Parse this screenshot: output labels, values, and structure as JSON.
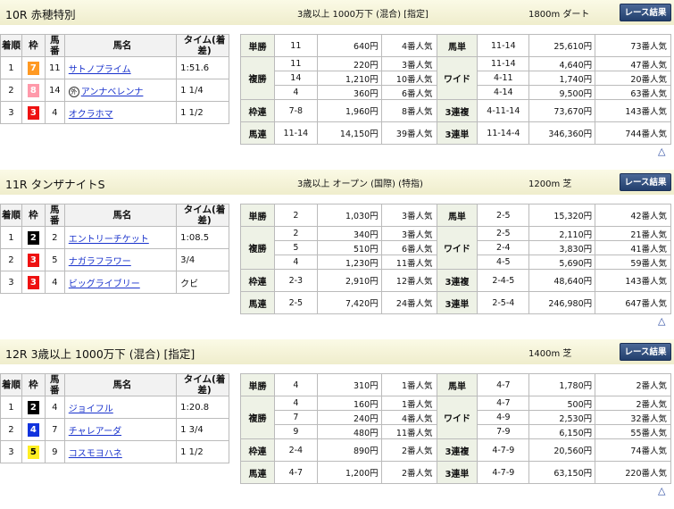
{
  "colors": {
    "waku1": "#ffffff",
    "waku2": "#000000",
    "waku3": "#ee1111",
    "waku4": "#1133dd",
    "waku5": "#ffee22",
    "waku6": "#22aa33",
    "waku7": "#ff9922",
    "waku8": "#ff99aa"
  },
  "result_headers": {
    "pos": "着順",
    "waku": "枠",
    "num": "馬番",
    "name": "馬名",
    "time": "タイム(着差)"
  },
  "races": [
    {
      "name": "10R 赤穂特別",
      "cond": "3歳以上 1000万下 (混合) [指定]",
      "dist": "1800m ダート",
      "btn": "レース結果",
      "results": [
        {
          "pos": "1",
          "waku": "7",
          "num": "11",
          "name": "サトノプライム",
          "mark": "",
          "time": "1:51.6",
          "wbg": "#ff9922",
          "wfg": "#ffffff"
        },
        {
          "pos": "2",
          "waku": "8",
          "num": "14",
          "name": "アンナベレンナ",
          "mark": "外",
          "time": "1 1/4",
          "wbg": "#ff99aa",
          "wfg": "#ffffff"
        },
        {
          "pos": "3",
          "waku": "3",
          "num": "4",
          "name": "オクラホマ",
          "mark": "",
          "time": "1 1/2",
          "wbg": "#ee1111",
          "wfg": "#ffffff"
        }
      ],
      "pay": {
        "tan": {
          "l": "単勝",
          "c": "11",
          "a": "640円",
          "p": "4番人気"
        },
        "fuku": {
          "l": "複勝",
          "c": [
            "11",
            "14",
            "4"
          ],
          "a": [
            "220円",
            "1,210円",
            "360円"
          ],
          "p": [
            "3番人気",
            "10番人気",
            "6番人気"
          ]
        },
        "waku": {
          "l": "枠連",
          "c": "7-8",
          "a": "1,960円",
          "p": "8番人気"
        },
        "umaren": {
          "l": "馬連",
          "c": "11-14",
          "a": "14,150円",
          "p": "39番人気"
        },
        "umatan": {
          "l": "馬単",
          "c": "11-14",
          "a": "25,610円",
          "p": "73番人気"
        },
        "wide": {
          "l": "ワイド",
          "c": [
            "11-14",
            "4-11",
            "4-14"
          ],
          "a": [
            "4,640円",
            "1,740円",
            "9,500円"
          ],
          "p": [
            "47番人気",
            "20番人気",
            "63番人気"
          ]
        },
        "trio": {
          "l": "3連複",
          "c": "4-11-14",
          "a": "73,670円",
          "p": "143番人気"
        },
        "trifecta": {
          "l": "3連単",
          "c": "11-14-4",
          "a": "346,360円",
          "p": "744番人気"
        }
      }
    },
    {
      "name": "11R タンザナイトS",
      "cond": "3歳以上 オープン (国際) (特指)",
      "dist": "1200m 芝",
      "btn": "レース結果",
      "results": [
        {
          "pos": "1",
          "waku": "2",
          "num": "2",
          "name": "エントリーチケット",
          "mark": "",
          "time": "1:08.5",
          "wbg": "#000000",
          "wfg": "#ffffff"
        },
        {
          "pos": "2",
          "waku": "3",
          "num": "5",
          "name": "ナガラフラワー",
          "mark": "",
          "time": "3/4",
          "wbg": "#ee1111",
          "wfg": "#ffffff"
        },
        {
          "pos": "3",
          "waku": "3",
          "num": "4",
          "name": "ビッグライブリー",
          "mark": "",
          "time": "クビ",
          "wbg": "#ee1111",
          "wfg": "#ffffff"
        }
      ],
      "pay": {
        "tan": {
          "l": "単勝",
          "c": "2",
          "a": "1,030円",
          "p": "3番人気"
        },
        "fuku": {
          "l": "複勝",
          "c": [
            "2",
            "5",
            "4"
          ],
          "a": [
            "340円",
            "510円",
            "1,230円"
          ],
          "p": [
            "3番人気",
            "6番人気",
            "11番人気"
          ]
        },
        "waku": {
          "l": "枠連",
          "c": "2-3",
          "a": "2,910円",
          "p": "12番人気"
        },
        "umaren": {
          "l": "馬連",
          "c": "2-5",
          "a": "7,420円",
          "p": "24番人気"
        },
        "umatan": {
          "l": "馬単",
          "c": "2-5",
          "a": "15,320円",
          "p": "42番人気"
        },
        "wide": {
          "l": "ワイド",
          "c": [
            "2-5",
            "2-4",
            "4-5"
          ],
          "a": [
            "2,110円",
            "3,830円",
            "5,690円"
          ],
          "p": [
            "21番人気",
            "41番人気",
            "59番人気"
          ]
        },
        "trio": {
          "l": "3連複",
          "c": "2-4-5",
          "a": "48,640円",
          "p": "143番人気"
        },
        "trifecta": {
          "l": "3連単",
          "c": "2-5-4",
          "a": "246,980円",
          "p": "647番人気"
        }
      }
    },
    {
      "name": "12R 3歳以上 1000万下 (混合) [指定]",
      "cond": "",
      "dist": "1400m 芝",
      "btn": "レース結果",
      "results": [
        {
          "pos": "1",
          "waku": "2",
          "num": "4",
          "name": "ジョイフル",
          "mark": "",
          "time": "1:20.8",
          "wbg": "#000000",
          "wfg": "#ffffff"
        },
        {
          "pos": "2",
          "waku": "4",
          "num": "7",
          "name": "チャレアーダ",
          "mark": "",
          "time": "1 3/4",
          "wbg": "#1133dd",
          "wfg": "#ffffff"
        },
        {
          "pos": "3",
          "waku": "5",
          "num": "9",
          "name": "コスモヨハネ",
          "mark": "",
          "time": "1 1/2",
          "wbg": "#ffee22",
          "wfg": "#000000"
        }
      ],
      "pay": {
        "tan": {
          "l": "単勝",
          "c": "4",
          "a": "310円",
          "p": "1番人気"
        },
        "fuku": {
          "l": "複勝",
          "c": [
            "4",
            "7",
            "9"
          ],
          "a": [
            "160円",
            "240円",
            "480円"
          ],
          "p": [
            "1番人気",
            "4番人気",
            "11番人気"
          ]
        },
        "waku": {
          "l": "枠連",
          "c": "2-4",
          "a": "890円",
          "p": "2番人気"
        },
        "umaren": {
          "l": "馬連",
          "c": "4-7",
          "a": "1,200円",
          "p": "2番人気"
        },
        "umatan": {
          "l": "馬単",
          "c": "4-7",
          "a": "1,780円",
          "p": "2番人気"
        },
        "wide": {
          "l": "ワイド",
          "c": [
            "4-7",
            "4-9",
            "7-9"
          ],
          "a": [
            "500円",
            "2,530円",
            "6,150円"
          ],
          "p": [
            "2番人気",
            "32番人気",
            "55番人気"
          ]
        },
        "trio": {
          "l": "3連複",
          "c": "4-7-9",
          "a": "20,560円",
          "p": "74番人気"
        },
        "trifecta": {
          "l": "3連単",
          "c": "4-7-9",
          "a": "63,150円",
          "p": "220番人気"
        }
      }
    }
  ],
  "scroll_up": "△"
}
